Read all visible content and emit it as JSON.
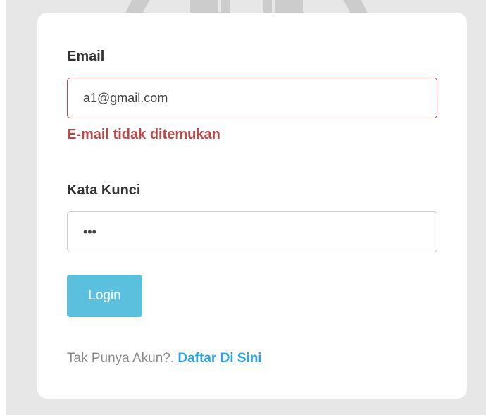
{
  "form": {
    "email_label": "Email",
    "email_value": "a1@gmail.com",
    "email_error": "E-mail tidak ditemukan",
    "password_label": "Kata Kunci",
    "password_value": "abc",
    "login_label": "Login",
    "signup_prompt": "Tak Punya Akun?.",
    "signup_link": "Daftar Di Sini"
  },
  "colors": {
    "error": "#b94a48",
    "button": "#5bc0de",
    "link": "#2aa3e8",
    "backdrop": "#e7e7e7"
  }
}
